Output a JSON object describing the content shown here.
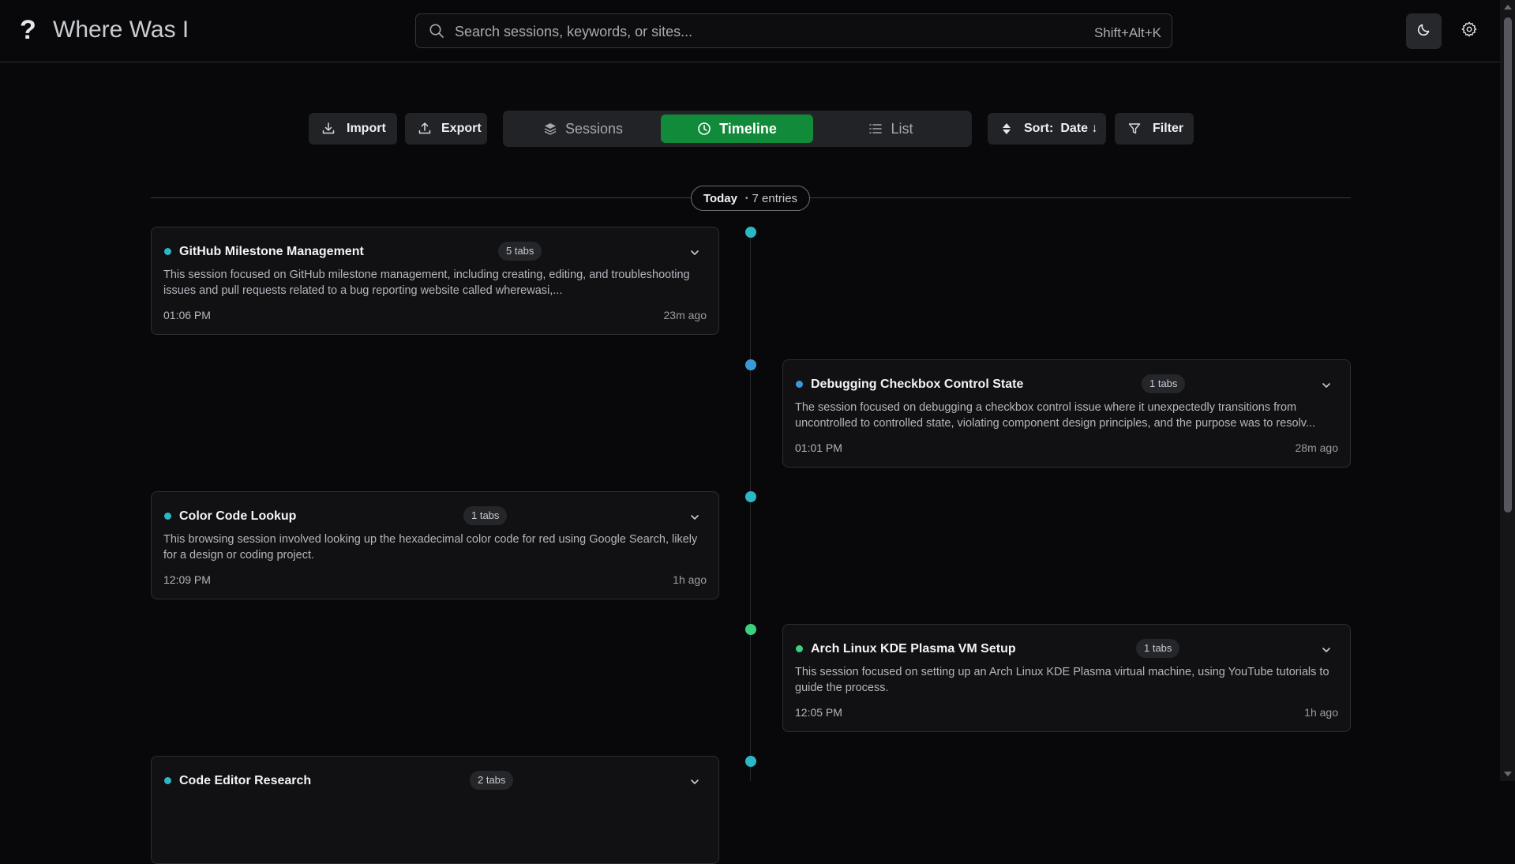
{
  "app": {
    "logo_glyph": "?",
    "title": "Where Was I"
  },
  "search": {
    "placeholder": "Search sessions, keywords, or sites...",
    "shortcut": "Shift+Alt+K"
  },
  "toolbar": {
    "import_label": "Import",
    "export_label": "Export",
    "views": [
      {
        "label": "Sessions",
        "icon": "layers-icon",
        "active": false
      },
      {
        "label": "Timeline",
        "icon": "clock-icon",
        "active": true
      },
      {
        "label": "List",
        "icon": "list-icon",
        "active": false
      }
    ],
    "sort_label": "Sort:",
    "sort_value": "Date ↓",
    "filter_label": "Filter"
  },
  "colors": {
    "accent_green": "#118a3a",
    "teal": "#2bb7c4",
    "blue": "#3a9ad9",
    "green": "#3ccf7e",
    "background": "#08080a"
  },
  "timeline": {
    "day": "Today",
    "separator": "•",
    "count": "7 entries",
    "entries": [
      {
        "title": "GitHub Milestone Management",
        "tabs": "5 tabs",
        "description": "This session focused on GitHub milestone management, including creating, editing, and troubleshooting issues and pull requests related to a bug reporting website called wherewasi,...",
        "time": "01:06 PM",
        "ago": "23m ago",
        "color": "#2bb7c4"
      },
      {
        "title": "Debugging Checkbox Control State",
        "tabs": "1 tabs",
        "description": "The session focused on debugging a checkbox control issue where it unexpectedly transitions from uncontrolled to controlled state, violating component design principles, and the purpose was to resolv...",
        "time": "01:01 PM",
        "ago": "28m ago",
        "color": "#3a9ad9"
      },
      {
        "title": "Color Code Lookup",
        "tabs": "1 tabs",
        "description": "This browsing session involved looking up the hexadecimal color code for red using Google Search, likely for a design or coding project.",
        "time": "12:09 PM",
        "ago": "1h ago",
        "color": "#2bb7c4"
      },
      {
        "title": "Arch Linux KDE Plasma VM Setup",
        "tabs": "1 tabs",
        "description": "This session focused on setting up an Arch Linux KDE Plasma virtual machine, using YouTube tutorials to guide the process.",
        "time": "12:05 PM",
        "ago": "1h ago",
        "color": "#3ccf7e"
      },
      {
        "title": "Code Editor Research",
        "tabs": "2 tabs",
        "description": "",
        "time": "",
        "ago": "",
        "color": "#2bb7c4"
      }
    ]
  }
}
